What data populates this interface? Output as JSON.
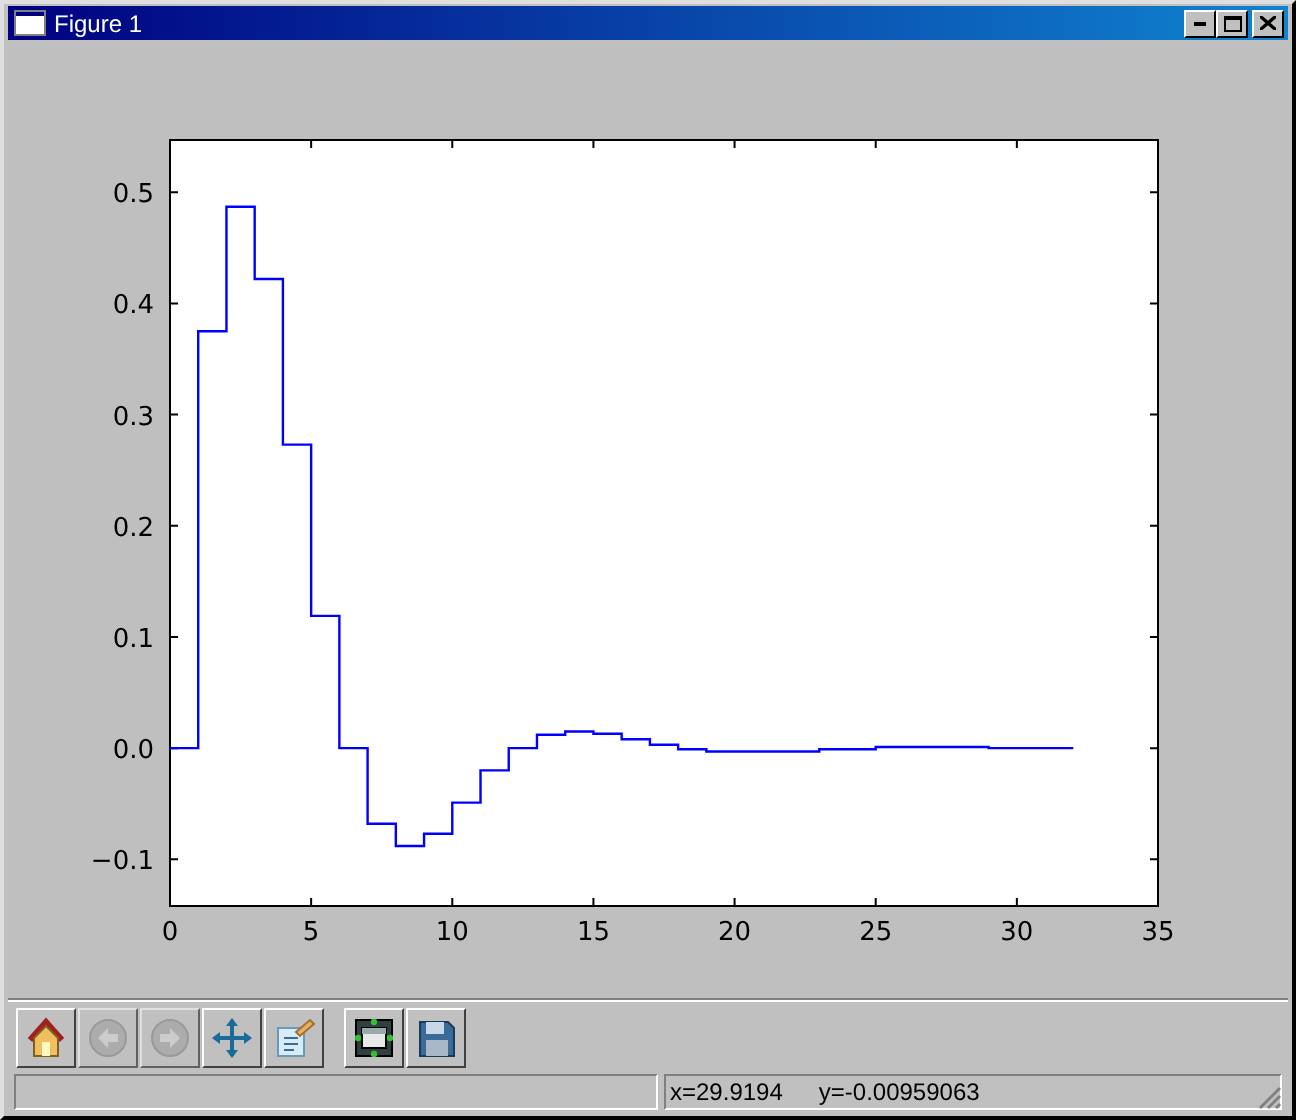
{
  "window": {
    "title": "Figure 1"
  },
  "figure": {
    "chart_data": {
      "type": "line",
      "x": [
        0,
        1,
        1,
        2,
        2,
        3,
        3,
        4,
        4,
        5,
        5,
        6,
        6,
        7,
        7,
        8,
        8,
        9,
        9,
        10,
        10,
        11,
        11,
        12,
        12,
        13,
        13,
        14,
        14,
        15,
        15,
        16,
        16,
        17,
        17,
        18,
        18,
        19,
        19,
        23,
        23,
        25,
        25,
        29,
        29,
        32
      ],
      "series": [
        {
          "color": "#0000ff",
          "values": [
            0,
            0,
            0.375,
            0.375,
            0.487,
            0.487,
            0.422,
            0.422,
            0.273,
            0.273,
            0.119,
            0.119,
            0,
            0,
            -0.068,
            -0.068,
            -0.088,
            -0.088,
            -0.077,
            -0.077,
            -0.049,
            -0.049,
            -0.02,
            -0.02,
            0,
            0,
            0.012,
            0.012,
            0.015,
            0.015,
            0.013,
            0.013,
            0.008,
            0.008,
            0.003,
            0.003,
            -0.001,
            -0.001,
            -0.003,
            -0.003,
            -0.001,
            -0.001,
            0.001,
            0.001,
            0,
            0
          ]
        }
      ],
      "xlim": [
        0,
        35
      ],
      "ylim": [
        -0.142,
        0.547
      ],
      "xticks": [
        0,
        5,
        10,
        15,
        20,
        25,
        30,
        35
      ],
      "yticks": [
        {
          "value": -0.1,
          "label": "−0.1"
        },
        {
          "value": 0,
          "label": "0.0"
        },
        {
          "value": 0.1,
          "label": "0.1"
        },
        {
          "value": 0.2,
          "label": "0.2"
        },
        {
          "value": 0.3,
          "label": "0.3"
        },
        {
          "value": 0.4,
          "label": "0.4"
        },
        {
          "value": 0.5,
          "label": "0.5"
        }
      ]
    }
  },
  "toolbar": [
    {
      "kind": "home",
      "disabled": false
    },
    {
      "kind": "back",
      "disabled": true
    },
    {
      "kind": "forward",
      "disabled": true
    },
    {
      "kind": "pan",
      "disabled": false
    },
    {
      "kind": "subplots",
      "disabled": false
    },
    {
      "kind": "configure",
      "disabled": false
    },
    {
      "kind": "save",
      "disabled": false
    }
  ],
  "status_bar": {
    "coordinates": [
      "x=29.9194",
      "y=-0.00959063"
    ]
  }
}
